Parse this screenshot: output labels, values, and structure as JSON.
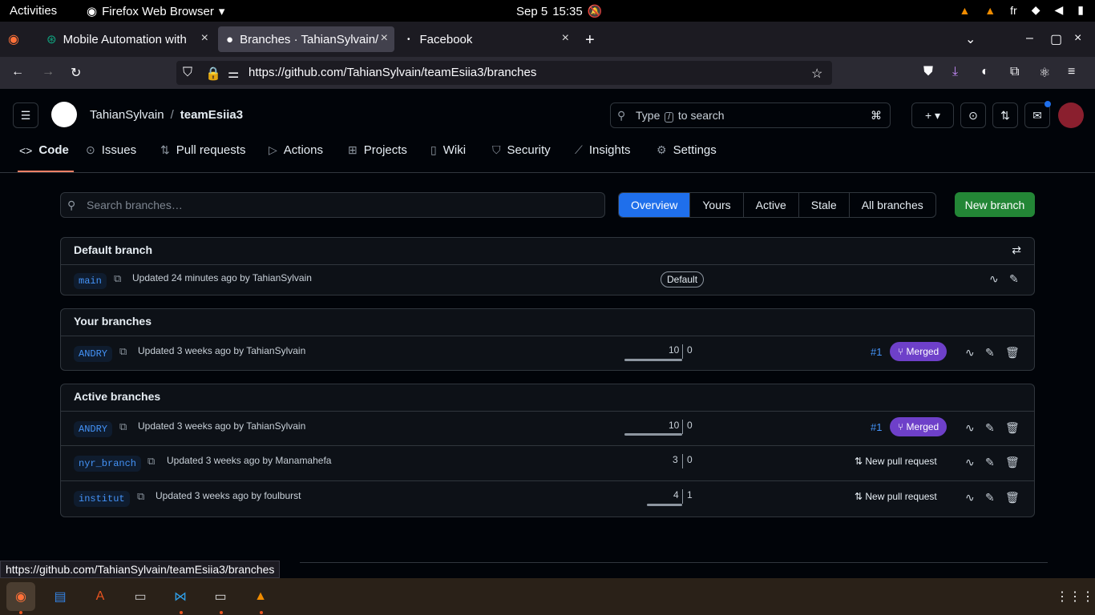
{
  "os": {
    "activities": "Activities",
    "app_name": "Firefox Web Browser",
    "date": "Sep 5",
    "time": "15:35",
    "lang": "fr"
  },
  "browser": {
    "tabs": [
      {
        "title": "Mobile Automation with"
      },
      {
        "title": "Branches · TahianSylvain/"
      },
      {
        "title": "Facebook"
      }
    ],
    "url": "https://github.com/TahianSylvain/teamEsiia3/branches",
    "status_url": "https://github.com/TahianSylvain/teamEsiia3/branches"
  },
  "github": {
    "owner": "TahianSylvain",
    "sep": "/",
    "repo": "teamEsiia3",
    "search_pre": "Type",
    "search_key": "/",
    "search_post": "to search",
    "nav": [
      "Code",
      "Issues",
      "Pull requests",
      "Actions",
      "Projects",
      "Wiki",
      "Security",
      "Insights",
      "Settings"
    ]
  },
  "branches": {
    "search_placeholder": "Search branches…",
    "filters": [
      "Overview",
      "Yours",
      "Active",
      "Stale",
      "All branches"
    ],
    "active_filter": "Overview",
    "new_branch": "New branch",
    "default": {
      "heading": "Default branch",
      "name": "main",
      "updated": "Updated 24 minutes ago by TahianSylvain",
      "badge": "Default"
    },
    "yours": {
      "heading": "Your branches",
      "rows": [
        {
          "name": "ANDRY",
          "updated": "Updated 3 weeks ago by TahianSylvain",
          "behind": "10",
          "ahead": "0",
          "pr": "#1",
          "pr_state": "Merged"
        }
      ]
    },
    "active": {
      "heading": "Active branches",
      "rows": [
        {
          "name": "ANDRY",
          "updated": "Updated 3 weeks ago by TahianSylvain",
          "behind": "10",
          "ahead": "0",
          "pr": "#1",
          "pr_state": "Merged"
        },
        {
          "name": "nyr_branch",
          "updated": "Updated 3 weeks ago by Manamahefa",
          "behind": "3",
          "ahead": "0",
          "action": "New pull request"
        },
        {
          "name": "institut",
          "updated": "Updated 3 weeks ago by foulburst",
          "behind": "4",
          "ahead": "1",
          "action": "New pull request"
        }
      ]
    }
  },
  "colors": {
    "accent": "#1f6feb",
    "new_branch": "#238636",
    "merged": "#6e40c9",
    "link": "#4493f8"
  }
}
